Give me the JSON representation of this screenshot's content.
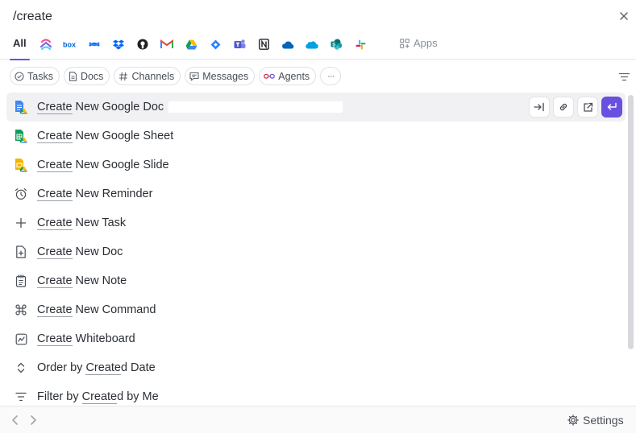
{
  "search": {
    "value": "/create"
  },
  "sources": {
    "all_label": "All",
    "icons": [
      "clickup-icon",
      "box-icon",
      "confluence-icon",
      "dropbox-icon",
      "github-icon",
      "gmail-icon",
      "google-drive-icon",
      "jira-icon",
      "teams-icon",
      "notion-icon",
      "onedrive-icon",
      "salesforce-icon",
      "sharepoint-icon",
      "slack-icon"
    ],
    "apps_label": "Apps"
  },
  "filters": {
    "chips": [
      "Tasks",
      "Docs",
      "Channels",
      "Messages",
      "Agents"
    ],
    "more_label": "···"
  },
  "results": [
    {
      "pre": "",
      "hl": "Create",
      "post": " New Google Doc",
      "icon": "google-doc-icon",
      "active": true
    },
    {
      "pre": "",
      "hl": "Create",
      "post": " New Google Sheet",
      "icon": "google-sheet-icon"
    },
    {
      "pre": "",
      "hl": "Create",
      "post": " New Google Slide",
      "icon": "google-slide-icon"
    },
    {
      "pre": "",
      "hl": "Create",
      "post": " New Reminder",
      "icon": "alarm-icon"
    },
    {
      "pre": "",
      "hl": "Create",
      "post": " New Task",
      "icon": "plus-icon"
    },
    {
      "pre": "",
      "hl": "Create",
      "post": " New Doc",
      "icon": "doc-icon"
    },
    {
      "pre": "",
      "hl": "Create",
      "post": " New Note",
      "icon": "note-icon"
    },
    {
      "pre": "",
      "hl": "Create",
      "post": " New Command",
      "icon": "command-icon"
    },
    {
      "pre": "",
      "hl": "Create",
      "post": " Whiteboard",
      "icon": "whiteboard-icon"
    },
    {
      "pre": "Order by ",
      "hl": "Create",
      "post": "d Date",
      "icon": "sort-icon"
    },
    {
      "pre": "Filter by ",
      "hl": "Create",
      "post": "d by Me",
      "icon": "filter-icon"
    }
  ],
  "footer": {
    "settings_label": "Settings"
  },
  "colors": {
    "accent": "#6a50e0",
    "text": "#2a2e34",
    "muted": "#8a8f98"
  }
}
